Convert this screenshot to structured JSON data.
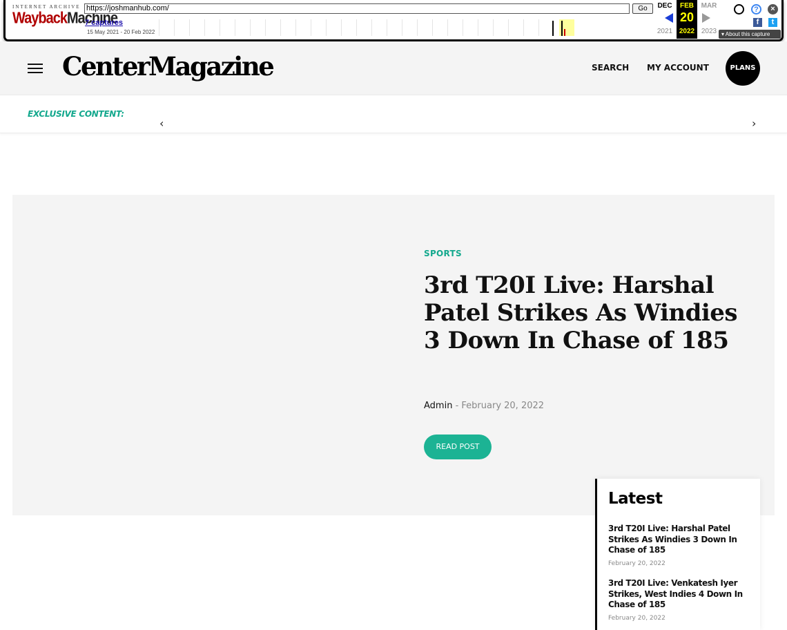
{
  "wayback": {
    "logo_top": "INTERNET ARCHIVE",
    "logo_way": "Wayback",
    "logo_machine": "Machine",
    "url": "https://joshmanhub.com/",
    "go_label": "Go",
    "captures": "7 captures",
    "range": "15 May 2021 - 20 Feb 2022",
    "prev_month": "DEC",
    "cur_month": "FEB",
    "next_month": "MAR",
    "cur_day": "20",
    "prev_year": "2021",
    "cur_year": "2022",
    "next_year": "2023",
    "about": "About this capture",
    "help_glyph": "?",
    "close_glyph": "×",
    "fb_glyph": "f",
    "tw_glyph": "t"
  },
  "header": {
    "logo": "CenterMagazine",
    "search": "SEARCH",
    "account": "MY ACCOUNT",
    "plans": "PLANS"
  },
  "exclusive": {
    "label": "EXCLUSIVE CONTENT:",
    "prev": "‹",
    "next": "›"
  },
  "hero": {
    "category": "SPORTS",
    "title": "3rd T20I Live: Harshal Patel Strikes As Windies 3 Down In Chase of 185",
    "author": "Admin",
    "separator": " - ",
    "date": "February 20, 2022",
    "button": "READ POST"
  },
  "latest": {
    "title": "Latest",
    "items": [
      {
        "title": "3rd T20I Live: Harshal Patel Strikes As Windies 3 Down In Chase of 185",
        "date": "February 20, 2022"
      },
      {
        "title": "3rd T20I Live: Venkatesh Iyer Strikes, West Indies 4 Down In Chase of 185",
        "date": "February 20, 2022"
      }
    ]
  },
  "colors": {
    "accent": "#1cb394",
    "accent_text": "#13a88d",
    "wayback_red": "#b00000"
  },
  "icons": {
    "menu": "hamburger-icon",
    "user": "user-icon",
    "help": "help-icon",
    "close": "close-icon",
    "facebook": "facebook-icon",
    "twitter": "twitter-icon"
  }
}
